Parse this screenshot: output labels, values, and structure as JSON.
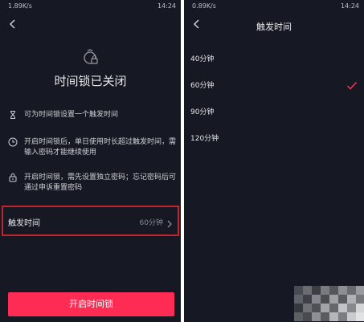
{
  "left_screen": {
    "status": {
      "speed": "1.89K/s",
      "time": "14:24"
    },
    "title": "时间锁已关闭",
    "info": [
      {
        "icon": "hourglass-icon",
        "text": "可为时间锁设置一个触发时间"
      },
      {
        "icon": "clock-icon",
        "text": "开启时间锁后，单日使用时长超过触发时间，需输入密码才能继续使用"
      },
      {
        "icon": "lock-icon",
        "text": "开启时间锁，需先设置独立密码；忘记密码后可通过申诉重置密码"
      }
    ],
    "trigger": {
      "label": "触发时间",
      "value": "60分钟"
    },
    "open_button": "开启时间锁"
  },
  "right_screen": {
    "status": {
      "speed": "0.89K/s",
      "time": "14:24"
    },
    "title": "触发时间",
    "options": [
      {
        "label": "40分钟",
        "selected": false
      },
      {
        "label": "60分钟",
        "selected": true
      },
      {
        "label": "90分钟",
        "selected": false
      },
      {
        "label": "120分钟",
        "selected": false
      }
    ]
  },
  "colors": {
    "background": "#161823",
    "accent": "#fe2c55",
    "highlight_box": "#c0242d"
  }
}
